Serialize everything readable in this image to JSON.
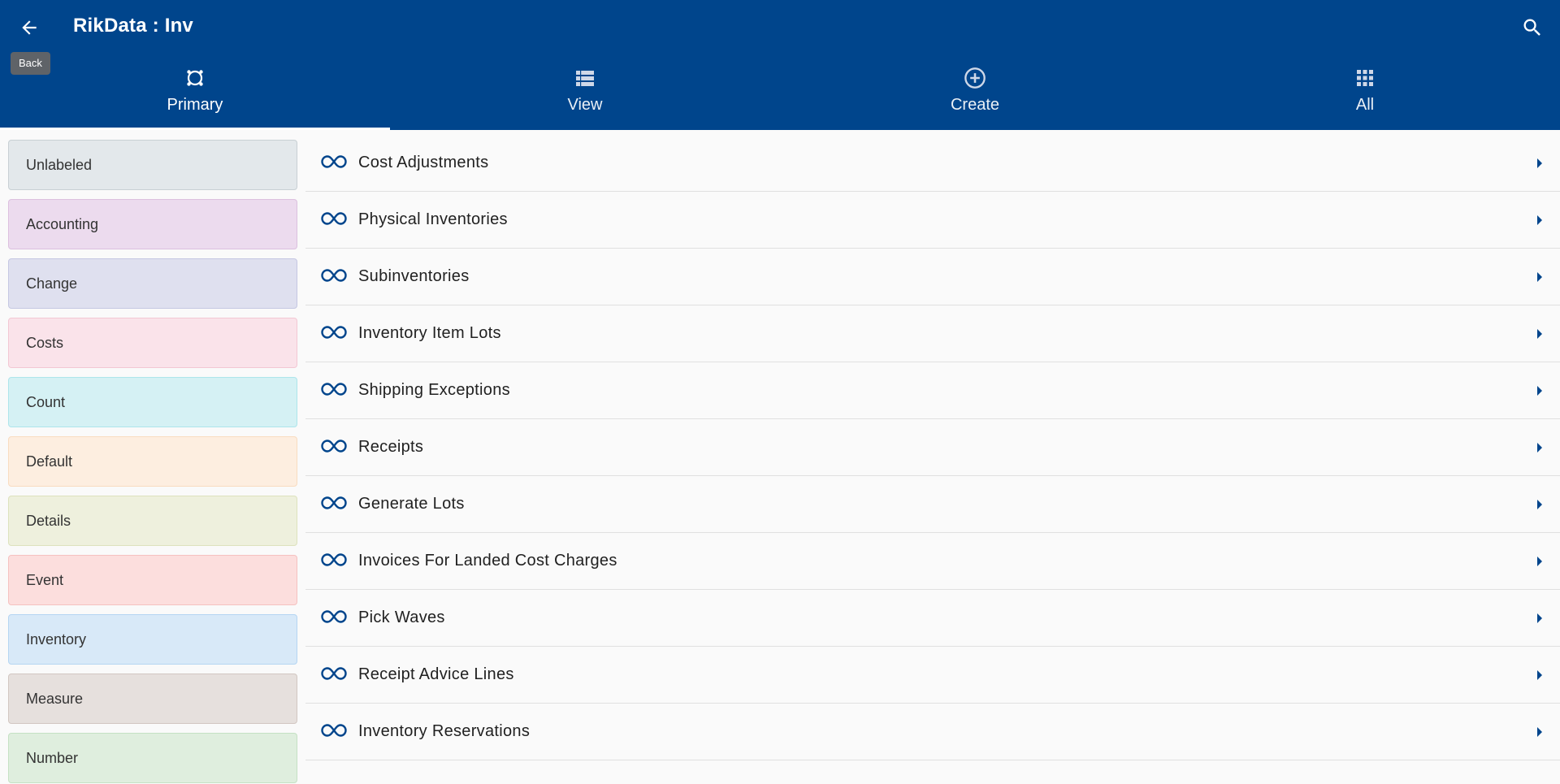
{
  "app": {
    "title": "RikData : Inv",
    "back_tooltip": "Back",
    "primary_color": "#00458c"
  },
  "tabs": [
    {
      "label": "Primary",
      "icon": "primary-icon",
      "active": true
    },
    {
      "label": "View",
      "icon": "view-list-icon",
      "active": false
    },
    {
      "label": "Create",
      "icon": "add-circle-icon",
      "active": false
    },
    {
      "label": "All",
      "icon": "apps-grid-icon",
      "active": false
    }
  ],
  "sidebar": {
    "items": [
      {
        "label": "Unlabeled",
        "bg": "#e3e8eb",
        "border": "#c8d0d4"
      },
      {
        "label": "Accounting",
        "bg": "#ecdbee",
        "border": "#dcc0df"
      },
      {
        "label": "Change",
        "bg": "#dfe0ef",
        "border": "#c5c7e2"
      },
      {
        "label": "Costs",
        "bg": "#fae3ea",
        "border": "#f3c7d3"
      },
      {
        "label": "Count",
        "bg": "#d5f1f4",
        "border": "#ade5eb"
      },
      {
        "label": "Default",
        "bg": "#fdeee0",
        "border": "#f9dcc0"
      },
      {
        "label": "Details",
        "bg": "#eef0dd",
        "border": "#dde2bd"
      },
      {
        "label": "Event",
        "bg": "#fcdedd",
        "border": "#f5c1c0"
      },
      {
        "label": "Inventory",
        "bg": "#d8e9f8",
        "border": "#b5d5f2"
      },
      {
        "label": "Measure",
        "bg": "#e6e0dd",
        "border": "#d2c7c2"
      },
      {
        "label": "Number",
        "bg": "#dfeede",
        "border": "#c5e1c4"
      }
    ]
  },
  "list": {
    "items": [
      {
        "label": "Cost Adjustments"
      },
      {
        "label": "Physical Inventories"
      },
      {
        "label": "Subinventories"
      },
      {
        "label": "Inventory Item Lots"
      },
      {
        "label": "Shipping Exceptions"
      },
      {
        "label": "Receipts"
      },
      {
        "label": "Generate Lots"
      },
      {
        "label": "Invoices For Landed Cost Charges"
      },
      {
        "label": "Pick Waves"
      },
      {
        "label": "Receipt Advice Lines"
      },
      {
        "label": "Inventory Reservations"
      }
    ]
  }
}
